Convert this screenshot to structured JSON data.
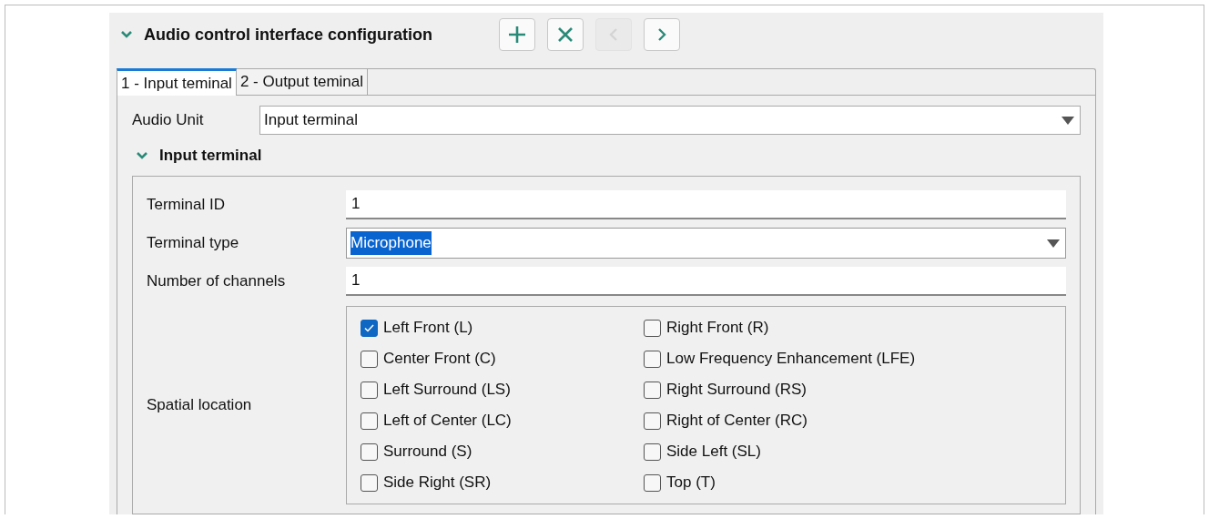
{
  "section": {
    "title": "Audio control interface configuration",
    "expanded": true
  },
  "toolbar": [
    {
      "kind": "add",
      "disabled": false
    },
    {
      "kind": "delete",
      "disabled": false
    },
    {
      "kind": "previous",
      "disabled": true
    },
    {
      "kind": "next",
      "disabled": false
    }
  ],
  "tabs": [
    {
      "label": "1 - Input teminal",
      "selected": true
    },
    {
      "label": "2 - Output teminal",
      "selected": false
    }
  ],
  "audio_unit": {
    "label": "Audio Unit",
    "value": "Input terminal"
  },
  "subsection": {
    "title": "Input terminal",
    "expanded": true
  },
  "fields": [
    {
      "kind": "text",
      "label": "Terminal ID",
      "value": "1"
    },
    {
      "kind": "dropdown",
      "label": "Terminal type",
      "value": "Microphone",
      "highlighted": true
    },
    {
      "kind": "text",
      "label": "Number of channels",
      "value": "1"
    }
  ],
  "spatial_location": {
    "label": "Spatial location",
    "options": [
      {
        "label": "Left Front (L)",
        "checked": true
      },
      {
        "label": "Right Front (R)",
        "checked": false
      },
      {
        "label": "Center Front (C)",
        "checked": false
      },
      {
        "label": "Low Frequency Enhancement (LFE)",
        "checked": false
      },
      {
        "label": "Left Surround (LS)",
        "checked": false
      },
      {
        "label": "Right Surround (RS)",
        "checked": false
      },
      {
        "label": "Left of Center (LC)",
        "checked": false
      },
      {
        "label": "Right of Center (RC)",
        "checked": false
      },
      {
        "label": "Surround (S)",
        "checked": false
      },
      {
        "label": "Side Left (SL)",
        "checked": false
      },
      {
        "label": "Side Right (SR)",
        "checked": false
      },
      {
        "label": "Top (T)",
        "checked": false
      }
    ]
  }
}
